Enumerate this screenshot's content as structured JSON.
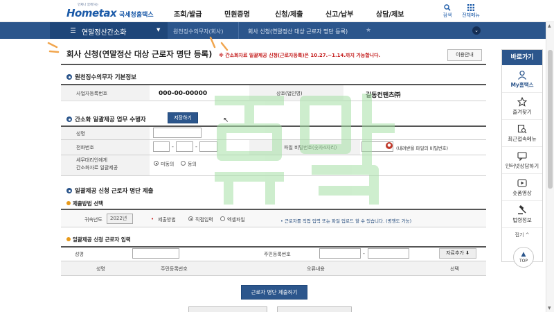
{
  "header": {
    "logo_text": "Hometax",
    "logo_tagline": "언제나 함께하는",
    "logo_name": "국세청홈택스",
    "nav": [
      "조회/발급",
      "민원증명",
      "신청/제출",
      "신고/납부",
      "상담/제보"
    ],
    "search_label": "검색",
    "allmenu_label": "전체메뉴"
  },
  "breadcrumb": {
    "menu_label": "연말정산간소화",
    "items": [
      "원천징수의무자(회사)",
      "회사 신청(연말정산 대상 근로자 명단 등록)"
    ]
  },
  "page": {
    "title": "회사 신청(연말정산 대상 근로자 명단 등록)",
    "notice": "※ 간소화자료 일괄제공 신청(근로자등록)은 10.27.~1.14.까지 가능합니다.",
    "guide_button": "이용안내"
  },
  "company_info": {
    "heading": "원천징수의무자 기본정보",
    "biz_no_label": "사업자등록번호",
    "biz_no_value": "000-00-00000",
    "company_name_label": "상호(법인명)",
    "company_name_value": "길동컨텐츠㈜"
  },
  "handler": {
    "heading": "간소화 일괄제공 업무 수행자",
    "load_button": "저장하기",
    "name_label": "성명",
    "phone_label": "전화번호",
    "file_pw_label": "파일 비밀번호(숫자4자리)",
    "file_pw_hint": "(내려받을 파일의 비밀번호)",
    "consent_label_line1": "세무대리인에게",
    "consent_label_line2": "간소화자료 일괄제공",
    "consent_options": [
      "미동의",
      "동의"
    ],
    "consent_selected": "미동의"
  },
  "submission": {
    "heading": "일괄제공 신청 근로자 명단 제출",
    "method_heading": "제출방법 선택",
    "year_label": "귀속년도",
    "year_value": "2022년",
    "method_label": "제출방법",
    "method_options": [
      "직접입력",
      "엑셀파일"
    ],
    "method_selected": "직접입력",
    "method_note": "• 근로자를 직접 입력 또는 파일 업로드 할 수 있습니다. (병행도 가능)",
    "employee_heading": "일괄제공 신청 근로자 입력",
    "emp_name_label": "성명",
    "emp_rrn_label": "주민등록번호",
    "add_button": "자료추가",
    "table_headers": [
      "성명",
      "주민등록번호",
      "오류내용",
      "선택"
    ],
    "submit_button": "근로자 명단 제출하기"
  },
  "quick_menu": {
    "title": "바로가기",
    "items": [
      {
        "label": "My홈택스",
        "icon": "person-icon"
      },
      {
        "label": "즐겨찾기",
        "icon": "star-icon"
      },
      {
        "label": "최근접속메뉴",
        "icon": "recent-search-icon"
      },
      {
        "label": "인터넷상담하기",
        "icon": "chat-icon"
      },
      {
        "label": "숏폼영상",
        "icon": "play-icon"
      },
      {
        "label": "법령정보",
        "icon": "gavel-icon"
      }
    ],
    "collapse_label": "접기 ^",
    "top_label": "TOP"
  },
  "colors": {
    "primary": "#2c568c",
    "primary_dark": "#1e4679",
    "notice_red": "#c41c1c",
    "sub_bullet": "#e89a1a"
  }
}
